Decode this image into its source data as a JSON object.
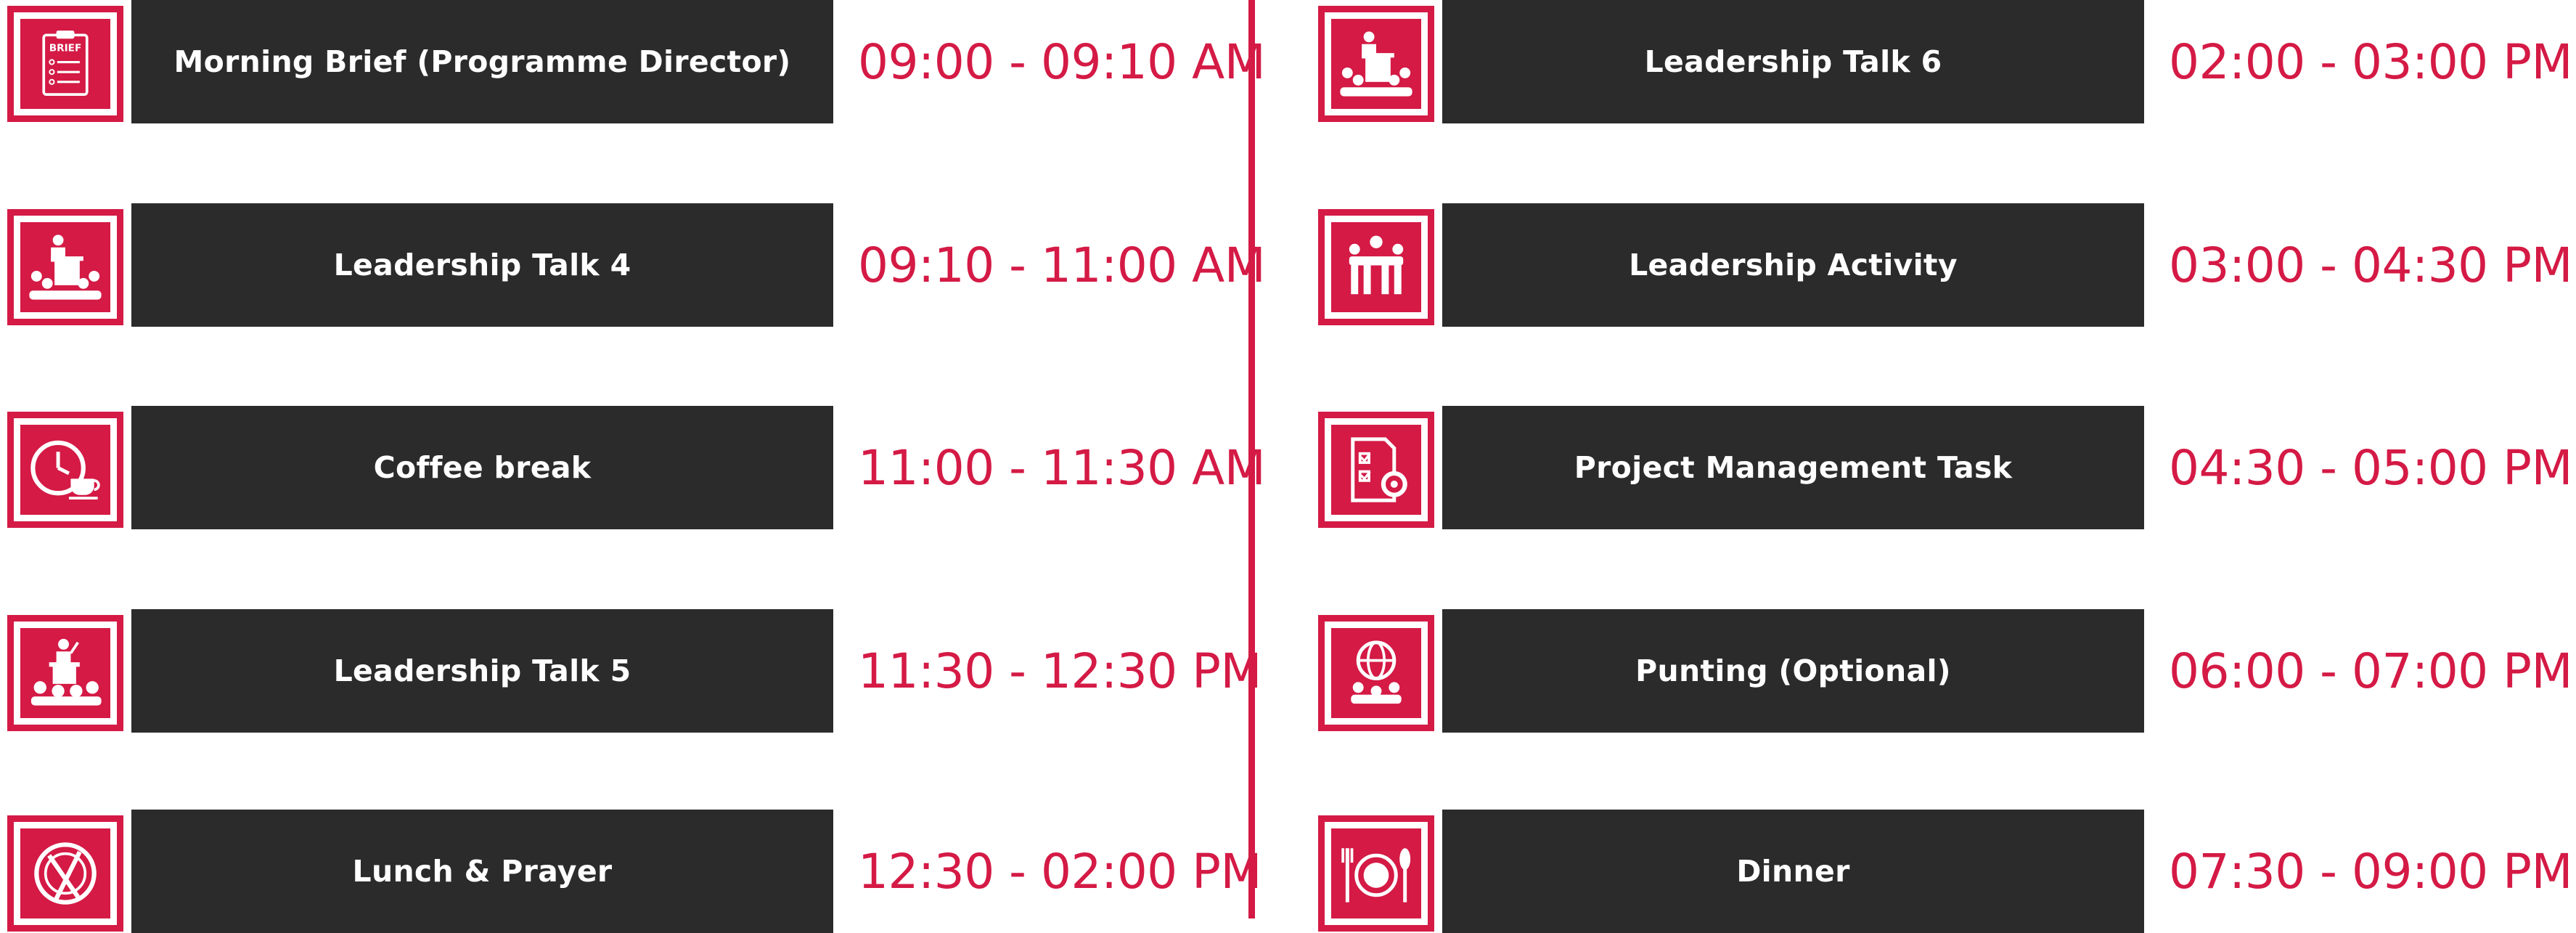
{
  "accent_color": "#d41a45",
  "bar_color": "#2b2b2b",
  "left_column": [
    {
      "title": "Morning Brief (Programme Director)",
      "time": "09:00 - 09:10 AM",
      "icon": "brief-clipboard-icon"
    },
    {
      "title": "Leadership Talk 4",
      "time": "09:10 - 11:00 AM",
      "icon": "speaker-podium-icon"
    },
    {
      "title": "Coffee break",
      "time": "11:00 - 11:30 AM",
      "icon": "clock-coffee-icon"
    },
    {
      "title": "Leadership Talk 5",
      "time": "11:30 - 12:30 PM",
      "icon": "speaker-audience-icon"
    },
    {
      "title": "Lunch & Prayer",
      "time": "12:30 - 02:00 PM",
      "icon": "plate-cutlery-icon"
    }
  ],
  "right_column": [
    {
      "title": "Leadership Talk 6",
      "time": "02:00 - 03:00 PM",
      "icon": "speaker-podium-icon"
    },
    {
      "title": "Leadership Activity",
      "time": "03:00 - 04:30 PM",
      "icon": "team-group-icon"
    },
    {
      "title": "Project Management Task",
      "time": "04:30 - 05:00 PM",
      "icon": "checklist-gear-icon"
    },
    {
      "title": "Punting (Optional)",
      "time": "06:00 - 07:00 PM",
      "icon": "globe-people-icon"
    },
    {
      "title": "Dinner",
      "time": "07:30 - 09:00 PM",
      "icon": "dinner-plate-icon"
    }
  ],
  "brief_icon_text": "BRIEF"
}
